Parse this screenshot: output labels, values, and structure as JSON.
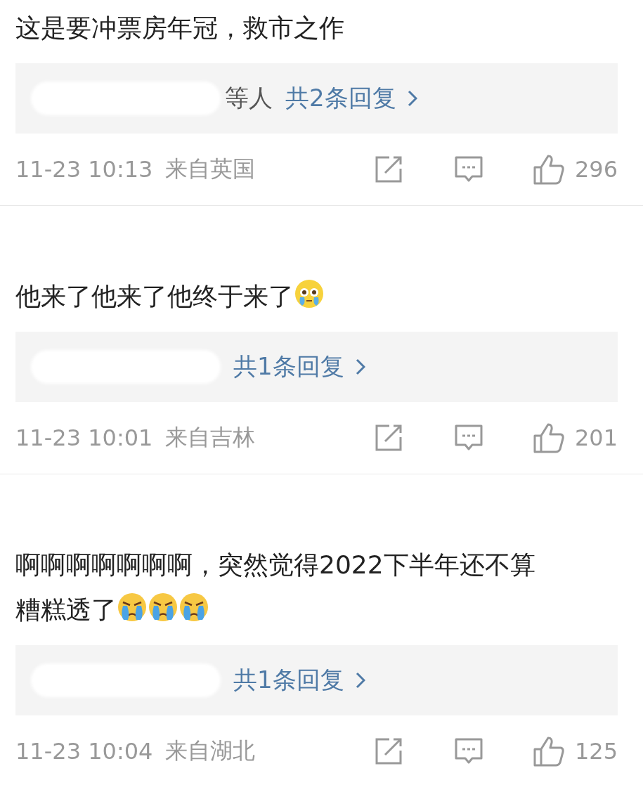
{
  "comments": [
    {
      "text": "这是要冲票房年冠，救市之作",
      "reply": {
        "others": "等人",
        "link": "共2条回复"
      },
      "time": "11-23 10:13",
      "location": "来自英国",
      "likes": "296"
    },
    {
      "text": "他来了他来了他终于来了",
      "emoji": [
        {
          "kind": "teary"
        }
      ],
      "reply": {
        "link": "共1条回复"
      },
      "time": "11-23 10:01",
      "location": "来自吉林",
      "likes": "201"
    },
    {
      "text": "啊啊啊啊啊啊啊，突然觉得2022下半年还不算糟糕透了",
      "emoji": [
        {
          "kind": "crying"
        },
        {
          "kind": "crying"
        },
        {
          "kind": "crying"
        }
      ],
      "reply": {
        "link": "共1条回复"
      },
      "time": "11-23 10:04",
      "location": "来自湖北",
      "likes": "125"
    }
  ]
}
